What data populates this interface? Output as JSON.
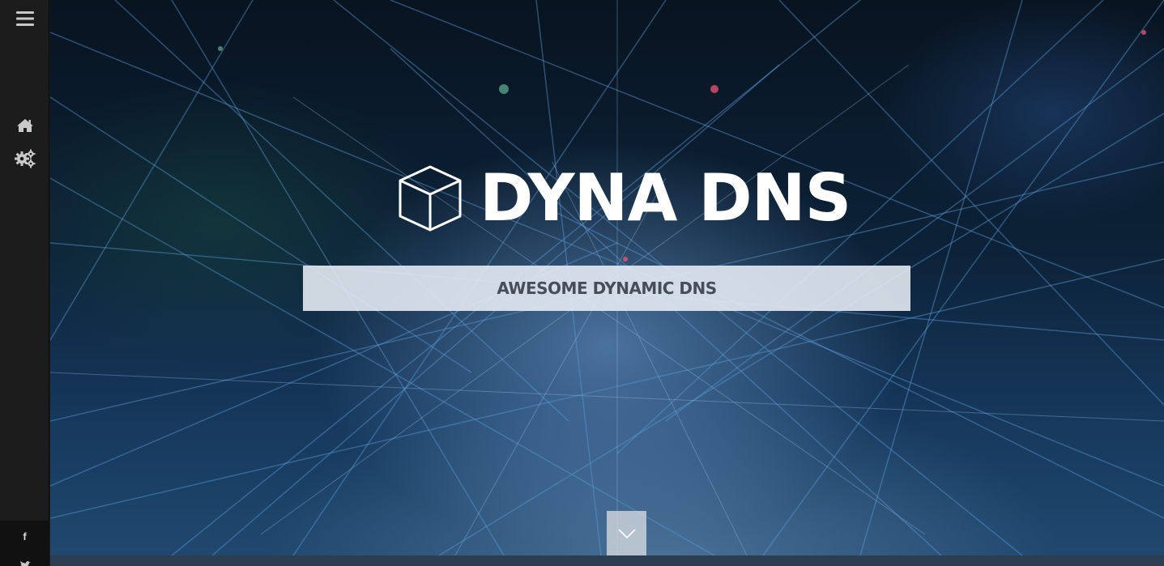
{
  "sidebar": {
    "menu_icon": "bars-icon",
    "nav": [
      {
        "icon": "home-icon",
        "label": "Home"
      },
      {
        "icon": "gears-icon",
        "label": "Settings"
      }
    ],
    "social": {
      "facebook_label": "f",
      "twitter_icon": "twitter-icon"
    }
  },
  "hero": {
    "logo_icon": "cube-icon",
    "title": "DYNA DNS",
    "tagline": "AWESOME DYNAMIC DNS",
    "scroll_icon": "chevron-down-icon"
  },
  "colors": {
    "sidebar_bg": "#1c1c1c",
    "title_text": "#ffffff",
    "tagline_bg": "#e8eef6",
    "tagline_text": "#474e58",
    "bottom_bar": "#2c3e50"
  }
}
